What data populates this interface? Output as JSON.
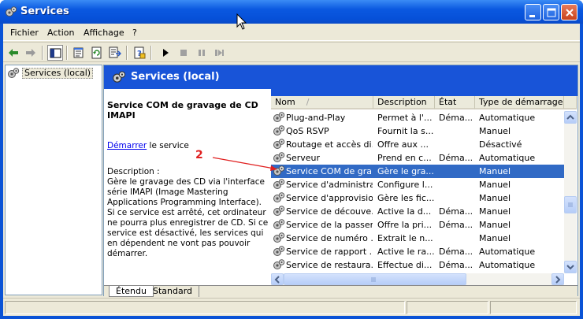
{
  "window": {
    "title": "Services"
  },
  "menu": [
    "Fichier",
    "Action",
    "Affichage",
    "?"
  ],
  "toolbar": {
    "buttons": [
      "back-icon",
      "forward-icon",
      "show-hide-tree-icon",
      "properties-icon",
      "refresh-icon",
      "export-list-icon",
      "help-icon",
      "play-icon",
      "stop-icon",
      "pause-icon",
      "restart-icon"
    ]
  },
  "tree": {
    "root_label": "Services (local)"
  },
  "header": {
    "title": "Services (local)"
  },
  "detail": {
    "service_name": "Service COM de gravage de CD IMAPI",
    "start_link": "Démarrer",
    "start_suffix": " le service",
    "description_label": "Description :",
    "description": "Gère le gravage des CD via l'interface série IMAPI (Image Mastering Applications Programming Interface). Si ce service est arrêté, cet ordinateur ne pourra plus enregistrer de CD. Si ce service est désactivé, les services qui en dépendent ne vont pas pouvoir démarrer."
  },
  "columns": [
    "Nom",
    "Description",
    "État",
    "Type de démarrage"
  ],
  "rows": [
    {
      "name": "Plug-and-Play",
      "desc": "Permet à l'...",
      "state": "Déma...",
      "startup": "Automatique"
    },
    {
      "name": "QoS RSVP",
      "desc": "Fournit la s...",
      "state": "",
      "startup": "Manuel"
    },
    {
      "name": "Routage et accès di...",
      "desc": "Offre aux ...",
      "state": "",
      "startup": "Désactivé"
    },
    {
      "name": "Serveur",
      "desc": "Prend en c...",
      "state": "Déma...",
      "startup": "Automatique"
    },
    {
      "name": "Service COM de gra...",
      "desc": "Gère le gra...",
      "state": "",
      "startup": "Manuel"
    },
    {
      "name": "Service d'administra...",
      "desc": "Configure l...",
      "state": "",
      "startup": "Manuel"
    },
    {
      "name": "Service d'approvisio...",
      "desc": "Gère les fic...",
      "state": "",
      "startup": "Manuel"
    },
    {
      "name": "Service de découve...",
      "desc": "Active la d...",
      "state": "Déma...",
      "startup": "Manuel"
    },
    {
      "name": "Service de la passer...",
      "desc": "Offre la pri...",
      "state": "Déma...",
      "startup": "Manuel"
    },
    {
      "name": "Service de numéro ...",
      "desc": "Extrait le n...",
      "state": "",
      "startup": "Manuel"
    },
    {
      "name": "Service de rapport ...",
      "desc": "Active le ra...",
      "state": "Déma...",
      "startup": "Automatique"
    },
    {
      "name": "Service de restaura...",
      "desc": "Effectue di...",
      "state": "Déma...",
      "startup": "Automatique"
    }
  ],
  "selected_row": 4,
  "tabs": [
    "Étendu",
    "Standard"
  ],
  "active_tab": "Étendu",
  "annotation": {
    "number": "2",
    "color": "#e02020"
  },
  "colors": {
    "selection": "#316ac5",
    "header_blue": "#1854d8",
    "titlebar": "#0a58e0",
    "face": "#ece9d8"
  }
}
